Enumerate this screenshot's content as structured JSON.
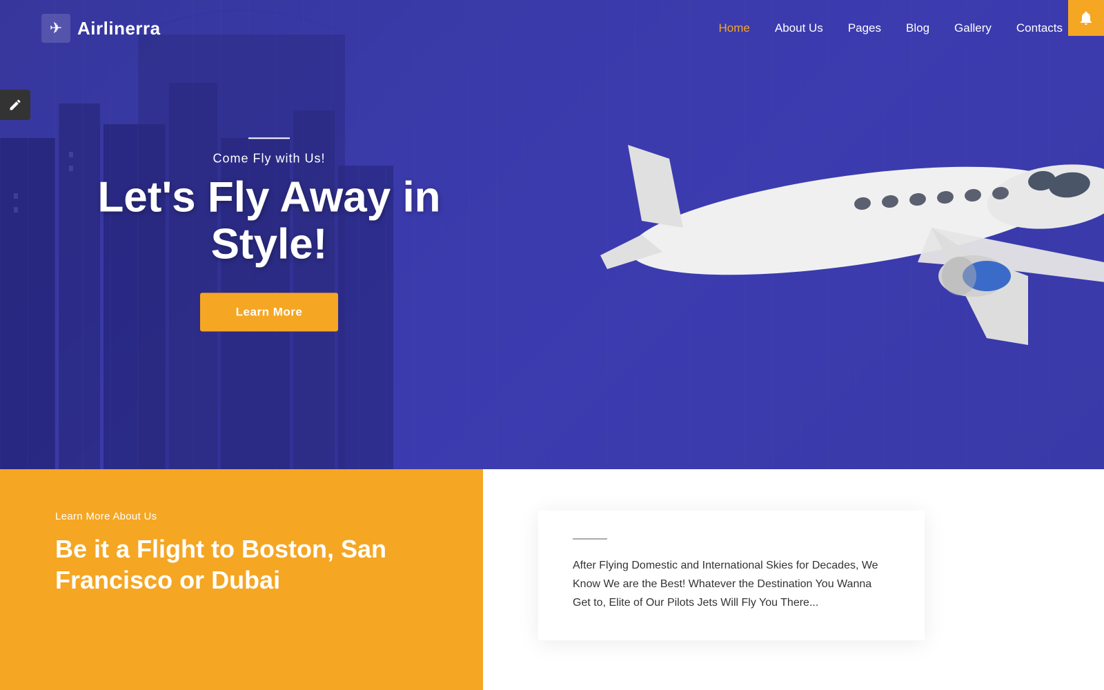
{
  "brand": {
    "logo_text": "Airlinerra",
    "logo_icon": "✈"
  },
  "nav": {
    "items": [
      {
        "label": "Home",
        "active": true
      },
      {
        "label": "About Us",
        "active": false
      },
      {
        "label": "Pages",
        "active": false
      },
      {
        "label": "Blog",
        "active": false
      },
      {
        "label": "Gallery",
        "active": false
      },
      {
        "label": "Contacts",
        "active": false
      }
    ]
  },
  "hero": {
    "subtitle": "Come Fly with Us!",
    "title": "Let's Fly Away in Style!",
    "cta_label": "Learn More"
  },
  "bottom": {
    "left_label": "Learn More About Us",
    "left_title": "Be it a Flight to Boston, San Francisco or Dubai",
    "right_text": "After Flying Domestic and International Skies for Decades, We Know We are the Best! Whatever the Destination You Wanna Get to, Elite of Our Pilots Jets Will Fly You There..."
  },
  "colors": {
    "accent": "#f5a623",
    "hero_bg": "#3535a8",
    "dark": "#2a2a6e"
  }
}
